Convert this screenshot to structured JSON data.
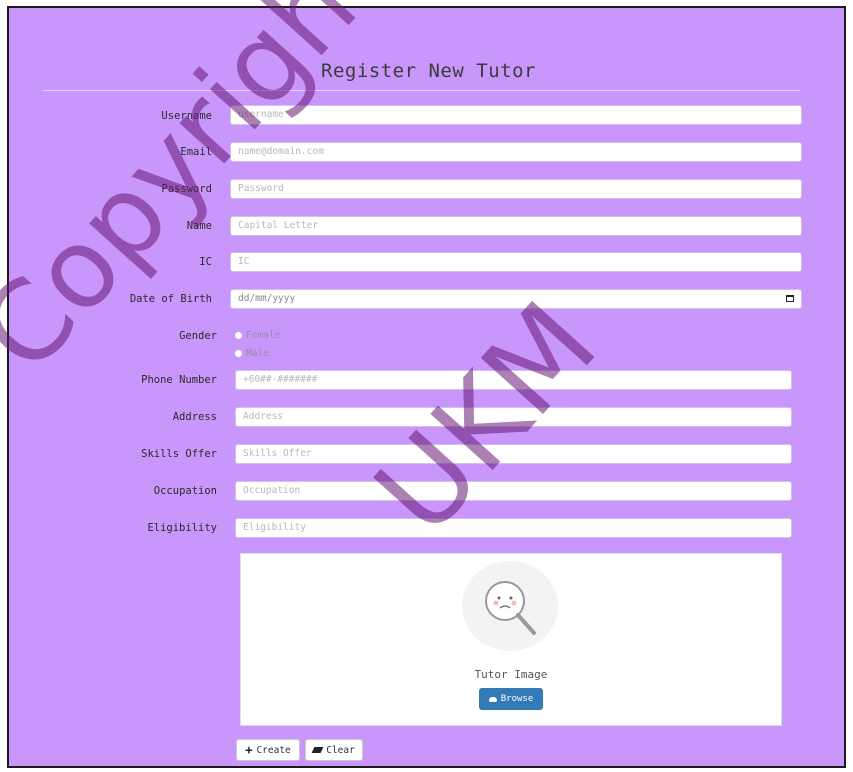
{
  "form": {
    "title": "Register New Tutor",
    "fields": {
      "username": {
        "label": "Username",
        "placeholder": "username"
      },
      "email": {
        "label": "Email",
        "placeholder": "name@domain.com"
      },
      "password": {
        "label": "Password",
        "placeholder": "Password"
      },
      "name": {
        "label": "Name",
        "placeholder": "Capital Letter"
      },
      "ic": {
        "label": "IC",
        "placeholder": "IC"
      },
      "dob": {
        "label": "Date of Birth",
        "placeholder": "dd/mm/yyyy"
      },
      "gender": {
        "label": "Gender",
        "options": [
          "Female",
          "Male"
        ]
      },
      "phone": {
        "label": "Phone Number",
        "placeholder": "+60##-#######"
      },
      "address": {
        "label": "Address",
        "placeholder": "Address"
      },
      "skills": {
        "label": "Skills Offer",
        "placeholder": "Skills Offer"
      },
      "occupation": {
        "label": "Occupation",
        "placeholder": "Occupation"
      },
      "eligibility": {
        "label": "Eligibility",
        "placeholder": "Eligibility"
      }
    },
    "image_upload": {
      "caption": "Tutor Image",
      "browse_label": "Browse"
    },
    "actions": {
      "create_label": "Create",
      "clear_label": "Clear"
    }
  },
  "watermark": {
    "line1": "Copyright@FTSM",
    "line2": "UKM"
  },
  "icons": {
    "dob": "calendar-icon",
    "browse": "cloud-upload-icon",
    "create": "plus-icon",
    "clear": "eraser-icon"
  },
  "colors": {
    "background": "#c996fb",
    "primary_button": "#337ab7",
    "watermark": "#641973"
  }
}
